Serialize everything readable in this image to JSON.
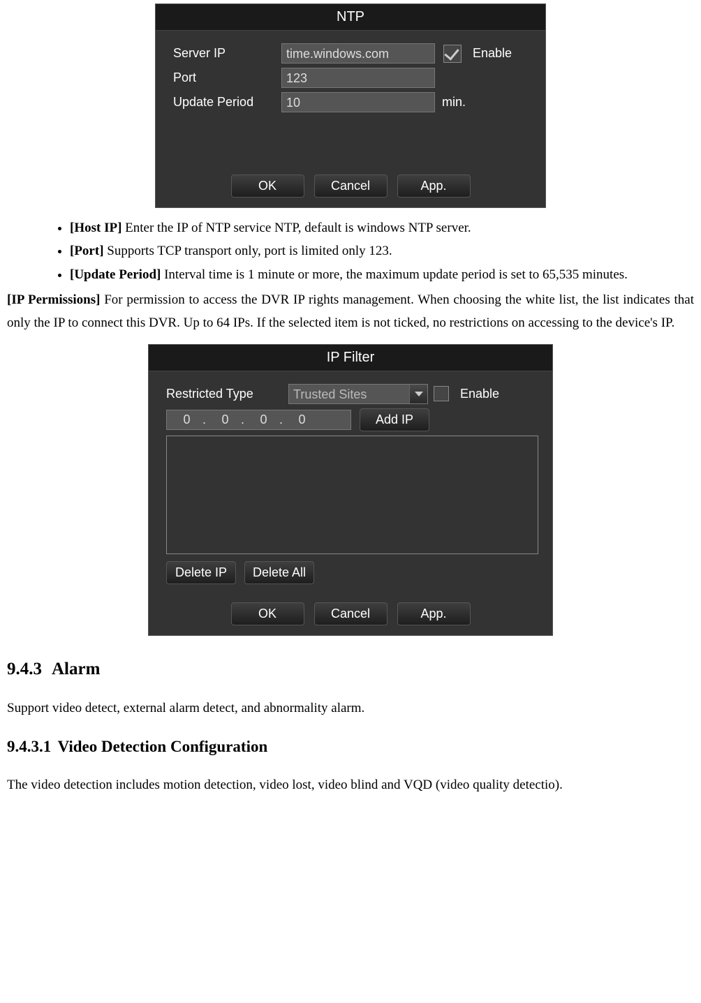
{
  "ntpDialog": {
    "title": "NTP",
    "serverIpLabel": "Server IP",
    "serverIpValue": "time.windows.com",
    "enableLabel": "Enable",
    "portLabel": "Port",
    "portValue": "123",
    "updatePeriodLabel": "Update Period",
    "updatePeriodValue": "10",
    "updatePeriodUnit": "min.",
    "okBtn": "OK",
    "cancelBtn": "Cancel",
    "appBtn": "App."
  },
  "bullets": {
    "hostIpLabel": "[Host IP]",
    "hostIpText": " Enter the IP of NTP service NTP, default is windows NTP server.",
    "portLabel": "[Port]",
    "portText": " Supports TCP transport only, port is limited only 123.",
    "updatePeriodLabel": "[Update Period]",
    "updatePeriodText": " Interval time is 1 minute or more, the maximum update period is set to 65,535 minutes."
  },
  "ipPermissions": {
    "label": "[IP Permissions]",
    "text": " For permission to access the DVR IP rights management. When choosing the white list, the list indicates that only the IP to connect this DVR. Up to 64 IPs. If the selected item is not ticked, no restrictions on accessing to the device's IP."
  },
  "ipFilterDialog": {
    "title": "IP Filter",
    "restrictedTypeLabel": "Restricted Type",
    "restrictedTypeValue": "Trusted Sites",
    "enableLabel": "Enable",
    "ipSeg1": "0",
    "ipSeg2": "0",
    "ipSeg3": "0",
    "ipSeg4": "0",
    "addIpBtn": "Add IP",
    "deleteIpBtn": "Delete IP",
    "deleteAllBtn": "Delete All",
    "okBtn": "OK",
    "cancelBtn": "Cancel",
    "appBtn": "App."
  },
  "sections": {
    "alarmNum": "9.4.3",
    "alarmTitle": "Alarm",
    "alarmText": "Support video detect, external alarm detect, and abnormality alarm.",
    "vdcNum": "9.4.3.1",
    "vdcTitle": "Video Detection Configuration",
    "vdcText": "The video detection includes motion detection, video lost, video blind and VQD (video quality detectio)."
  }
}
